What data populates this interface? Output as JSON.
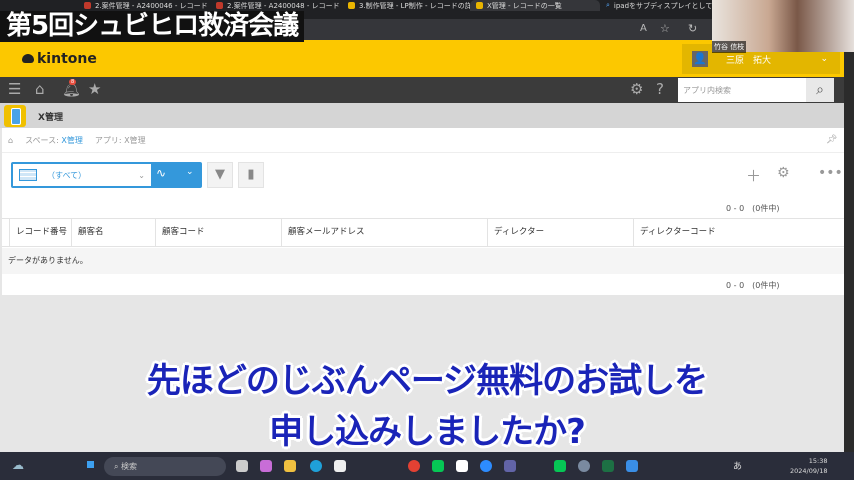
{
  "video_title": "第5回シュビヒロ救済会議",
  "browser": {
    "tabs": [
      {
        "label": "2.案件管理 - A2400046 - レコードの"
      },
      {
        "label": "2.案件管理 - A2400048 - レコードの"
      },
      {
        "label": "3.制作管理 - LP制作 - レコードの詳"
      },
      {
        "label": "X管理 - レコードの一覧",
        "active": true
      },
      {
        "label": "ipadをサブディスプレイとして使う win"
      }
    ]
  },
  "webcam": {
    "name": "竹谷 信枝"
  },
  "kintone": {
    "logo": "kintone",
    "user": "三原　拓大",
    "notification_count": "8",
    "search_placeholder": "アプリ内検索",
    "app_title": "X管理",
    "breadcrumb": {
      "space_label": "スペース:",
      "space": "X管理",
      "app": "アプリ: X管理"
    },
    "view": {
      "selected": "（すべて）"
    },
    "count_top": "0 - 0　(0件中)",
    "count_bottom": "0 - 0　(0件中)",
    "columns": [
      "レコード番号",
      "顧客名",
      "顧客コード",
      "顧客メールアドレス",
      "ディレクター",
      "ディレクターコード"
    ],
    "empty_message": "データがありません。",
    "accent": "#3498db",
    "header_color": "#fcc800"
  },
  "subtitle": {
    "line1": "先ほどのじぶんページ無料のお試しを",
    "line2": "申し込みしましたか?"
  },
  "taskbar": {
    "search": "検索",
    "time": "15:38",
    "date": "2024/09/18",
    "ime": "あ"
  }
}
